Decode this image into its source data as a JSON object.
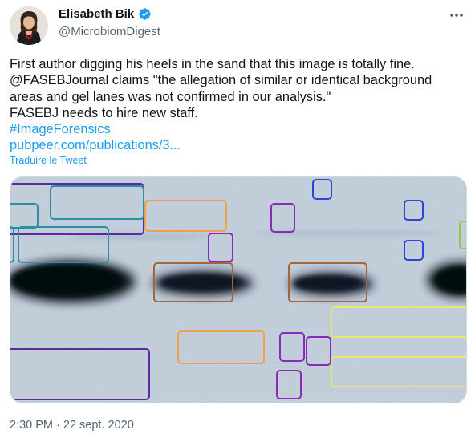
{
  "author": {
    "name": "Elisabeth Bik",
    "handle": "@MicrobiomDigest",
    "verified": true,
    "verified_color": "#1d9bf0"
  },
  "tweet": {
    "lines": [
      "First author digging his heels in the sand that this image is totally fine.",
      "@FASEBJournal claims \"the allegation of similar or identical background",
      "areas and gel lanes was not confirmed in our analysis.\"",
      "FASEBJ needs to hire new staff."
    ],
    "hashtag": "#ImageForensics",
    "link": "pubpeer.com/publications/3...",
    "translate": "Traduire le Tweet"
  },
  "meta": {
    "time": "2:30 PM",
    "separator": " · ",
    "date": "22 sept. 2020"
  },
  "icons": {
    "more": "more-horizontal-icon",
    "verified": "verified-badge-icon"
  },
  "colors": {
    "link": "#1d9bf0",
    "secondary_text": "#536471",
    "annotation_purple": "#5b2aa0",
    "annotation_teal": "#2b8fa3",
    "annotation_orange": "#f0a04a",
    "annotation_brown": "#a0683a",
    "annotation_magenta": "#8a2ab8",
    "annotation_blue": "#2946d8",
    "annotation_yellow": "#e8e86a",
    "annotation_green": "#8ac94a"
  }
}
